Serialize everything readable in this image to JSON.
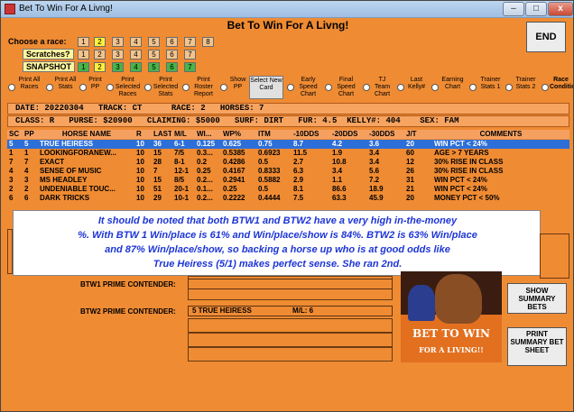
{
  "window": {
    "title": "Bet To Win For A Livng!",
    "close_glyph": "x",
    "min_glyph": "–",
    "max_glyph": "□"
  },
  "app_heading": "Bet To Win For A Livng!",
  "race_selector": {
    "choose_label": "Choose  a race:",
    "scratches_label": "Scratches?",
    "snapshot_label": "SNAPSHOT",
    "race_numbers": [
      "1",
      "2",
      "3",
      "4",
      "5",
      "6",
      "7",
      "8"
    ],
    "scratch_numbers": [
      "1",
      "2",
      "3",
      "4",
      "5",
      "6",
      "7"
    ],
    "snapshot_numbers": [
      "1",
      "2",
      "3",
      "4",
      "5",
      "6",
      "7"
    ]
  },
  "end_button": "END",
  "controls": [
    {
      "id": "print-all-races",
      "label": "Print All Races"
    },
    {
      "id": "print-all-stats",
      "label": "Print All Stats"
    },
    {
      "id": "print-pp",
      "label": "Print PP"
    },
    {
      "id": "print-selected-races",
      "label": "Print Selected Races"
    },
    {
      "id": "print-selected-stats",
      "label": "Print Selected Stats"
    },
    {
      "id": "print-roster-report",
      "label": "Print Roster Report"
    },
    {
      "id": "show-pp",
      "label": "Show PP"
    },
    {
      "id": "select-new-card",
      "label": "Select New Card"
    },
    {
      "id": "early-speed-chart",
      "label": "Early Speed Chart"
    },
    {
      "id": "final-speed-chart",
      "label": "Final Speed Chart"
    },
    {
      "id": "tj-team-chart",
      "label": "TJ Team Chart"
    },
    {
      "id": "last-kelly",
      "label": "Last Kelly#"
    },
    {
      "id": "earning-chart",
      "label": "Earning Chart"
    },
    {
      "id": "trainer-stats-1",
      "label": "Trainer Stats 1"
    },
    {
      "id": "trainer-stats-2",
      "label": "Trainer Stats 2"
    },
    {
      "id": "race-conditions",
      "label": "Race Conditions"
    }
  ],
  "race_info": {
    "line1": "DATE: 20220304   TRACK: CT      RACE: 2   HORSES: 7",
    "line2": "CLASS: R   PURSE: $20900   CLAIMING: $5000   SURF: DIRT   FUR: 4.5  KELLY#: 404    SEX: FAM"
  },
  "table": {
    "headers": [
      "SC",
      "PP",
      "HORSE NAME",
      "R",
      "LAST",
      "M/L",
      "WI...",
      "WP%",
      "ITM",
      "-10DDS",
      "-20DDS",
      "-30DDS",
      "J/T",
      "COMMENTS"
    ],
    "rows": [
      [
        "5",
        "5",
        "TRUE HEIRESS",
        "10",
        "36",
        "6-1",
        "0.125",
        "0.625",
        "0.75",
        "8.7",
        "4.2",
        "3.6",
        "20",
        "WIN PCT < 24%"
      ],
      [
        "1",
        "1",
        "LOOKINGFORANEW...",
        "10",
        "15",
        "7/5",
        "0.3...",
        "0.5385",
        "0.6923",
        "11.5",
        "1.9",
        "3.4",
        "60",
        "AGE > 7 YEARS"
      ],
      [
        "7",
        "7",
        "EXACT",
        "10",
        "28",
        "8-1",
        "0.2",
        "0.4286",
        "0.5",
        "2.7",
        "10.8",
        "3.4",
        "12",
        "30% RISE IN CLASS"
      ],
      [
        "4",
        "4",
        "SENSE OF MUSIC",
        "10",
        "7",
        "12-1",
        "0.25",
        "0.4167",
        "0.8333",
        "6.3",
        "3.4",
        "5.6",
        "26",
        "30% RISE IN CLASS"
      ],
      [
        "3",
        "3",
        "MS HEADLEY",
        "10",
        "15",
        "8/5",
        "0.2...",
        "0.2941",
        "0.5882",
        "2.9",
        "1.1",
        "7.2",
        "31",
        "WIN PCT < 24%"
      ],
      [
        "2",
        "2",
        "UNDENIABLE TOUC...",
        "10",
        "51",
        "20-1",
        "0.1...",
        "0.25",
        "0.5",
        "8.1",
        "86.6",
        "18.9",
        "21",
        "WIN PCT < 24%"
      ],
      [
        "6",
        "6",
        "DARK TRICKS",
        "10",
        "29",
        "10-1",
        "0.2...",
        "0.2222",
        "0.4444",
        "7.5",
        "63.3",
        "45.9",
        "20",
        "MONEY PCT < 50%"
      ]
    ]
  },
  "callout": {
    "line1": "It should be noted that both BTW1 and BTW2 have a very high in-the-money",
    "line2": "%.  With BTW 1 Win/place is 61% and Win/place/show is 84%.  BTW2 is 63% Win/place",
    "line3": "and 87% Win/place/show, so backing a horse up who is at good odds like",
    "line4": "True Heiress (5/1) makes perfect sense.  She ran 2nd."
  },
  "contenders": {
    "btw1_label": "BTW1 PRIME CONTENDER:",
    "btw1_value": "",
    "btw2_label": "BTW2 PRIME CONTENDER:",
    "btw2_value": "5  TRUE HEIRESS",
    "btw2_ml": "M/L:  6"
  },
  "side_buttons": {
    "show_summary": "SHOW SUMMARY BETS",
    "print_summary": "PRINT SUMMARY BET SHEET"
  },
  "logo": {
    "line1": "BET TO WIN",
    "line2": "FOR A LIVING!!"
  },
  "colors": {
    "background": "#ef8b33",
    "selected_row": "#2d6fd8",
    "callout_text": "#1d35d6"
  }
}
